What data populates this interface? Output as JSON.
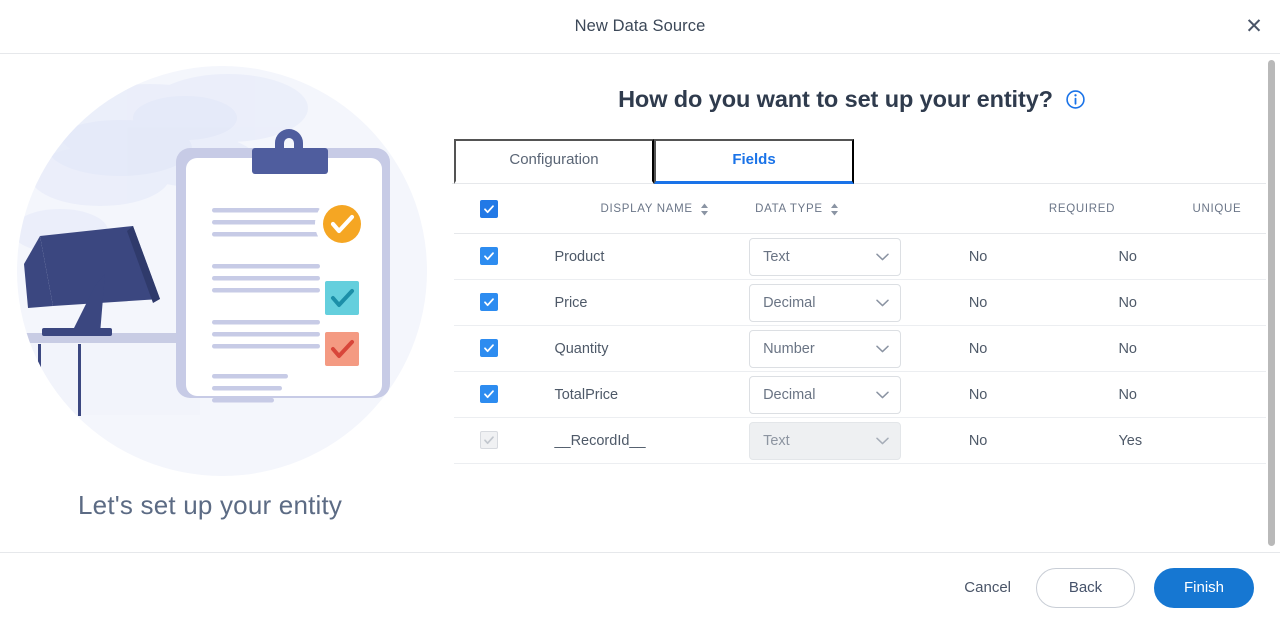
{
  "titlebar": {
    "title": "New Data Source",
    "close_label": "✕"
  },
  "left": {
    "caption": "Let's set up your entity",
    "illustration_name": "clipboard-checklist-illustration"
  },
  "main": {
    "heading": "How do you want to set up your entity?",
    "info_tooltip_icon": "info-circle-icon",
    "tabs": [
      {
        "label": "Configuration",
        "active": false
      },
      {
        "label": "Fields",
        "active": true
      }
    ],
    "table": {
      "select_all_checked": true,
      "columns": [
        {
          "key": "check",
          "label": "",
          "sortable": false
        },
        {
          "key": "name",
          "label": "DISPLAY NAME",
          "sortable": true
        },
        {
          "key": "type",
          "label": "DATA TYPE",
          "sortable": true
        },
        {
          "key": "req",
          "label": "REQUIRED",
          "sortable": false
        },
        {
          "key": "uniq",
          "label": "UNIQUE",
          "sortable": false
        }
      ],
      "rows": [
        {
          "checked": true,
          "disabled": false,
          "name": "Product",
          "type": "Text",
          "required": "No",
          "unique": "No"
        },
        {
          "checked": true,
          "disabled": false,
          "name": "Price",
          "type": "Decimal",
          "required": "No",
          "unique": "No"
        },
        {
          "checked": true,
          "disabled": false,
          "name": "Quantity",
          "type": "Number",
          "required": "No",
          "unique": "No"
        },
        {
          "checked": true,
          "disabled": false,
          "name": "TotalPrice",
          "type": "Decimal",
          "required": "No",
          "unique": "No"
        },
        {
          "checked": true,
          "disabled": true,
          "name": "__RecordId__",
          "type": "Text",
          "required": "No",
          "unique": "Yes"
        }
      ]
    }
  },
  "footer": {
    "cancel_label": "Cancel",
    "back_label": "Back",
    "finish_label": "Finish"
  },
  "colors": {
    "accent_blue": "#1a73e8",
    "primary_button": "#1677d2",
    "checkbox_blue": "#2d8cf0",
    "heading_text": "#2f3b4d",
    "body_text": "#4e5968",
    "muted_text": "#6b7688",
    "border": "#e6e8eb",
    "illustration_navy": "#3b4780",
    "illustration_orange": "#f5a623",
    "illustration_teal": "#64cfdd",
    "illustration_salmon": "#f49a82"
  }
}
